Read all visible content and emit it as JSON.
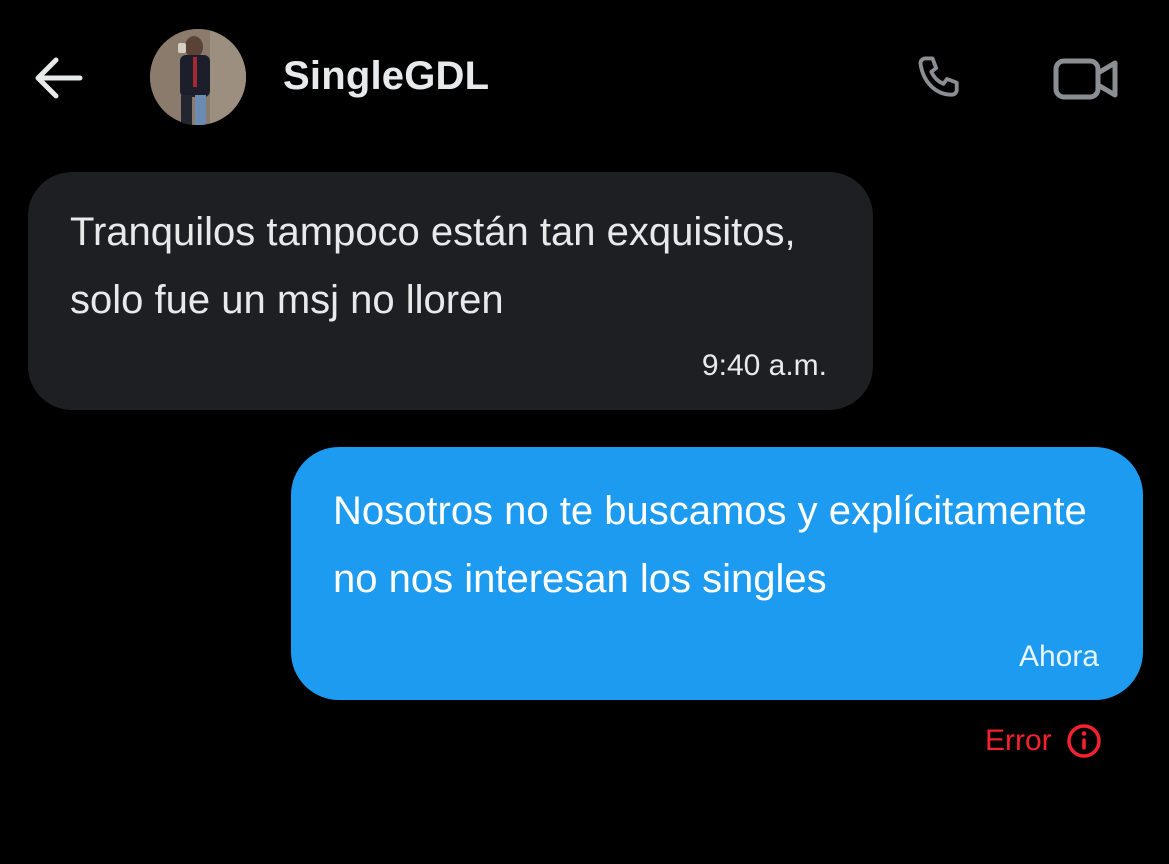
{
  "header": {
    "back_icon": "arrow-left-icon",
    "contact_name": "SingleGDL",
    "phone_icon": "phone-icon",
    "video_icon": "video-camera-icon"
  },
  "messages": [
    {
      "direction": "incoming",
      "text": "Tranquilos tampoco están tan exquisitos, solo fue un msj no lloren",
      "time": "9:40 a.m."
    },
    {
      "direction": "outgoing",
      "text": "Nosotros no te buscamos y explícitamente no nos interesan los singles",
      "time": "Ahora",
      "status": "Error",
      "status_icon": "info-circle-icon"
    }
  ],
  "colors": {
    "background": "#000000",
    "incoming_bubble": "#1d1f23",
    "outgoing_bubble": "#1d9bf0",
    "error": "#f4212e",
    "icon_gray": "#8b8f94"
  }
}
